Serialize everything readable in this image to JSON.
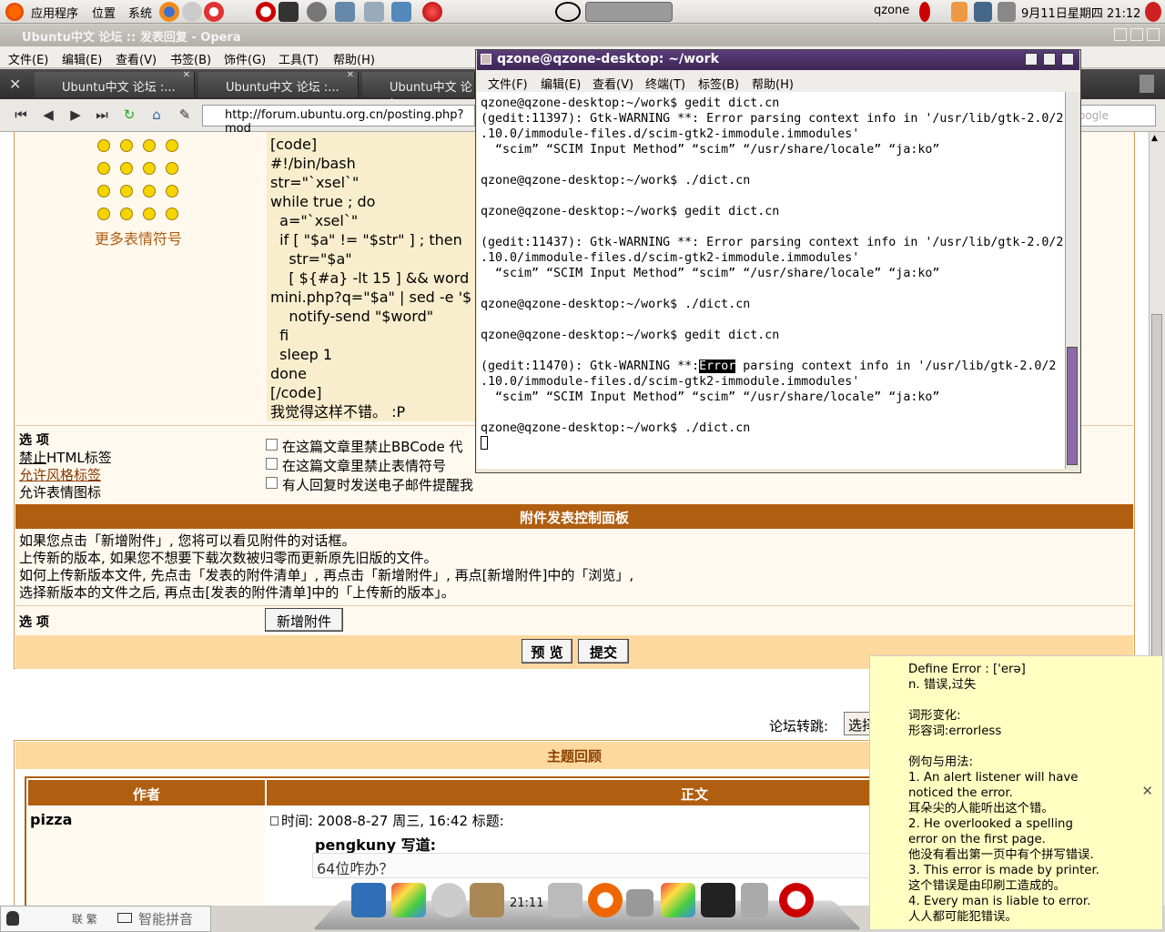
{
  "panel": {
    "menu_apps": "应用程序",
    "menu_places": "位置",
    "menu_system": "系统",
    "user": "qzone",
    "datetime": "9月11日星期四  21:12"
  },
  "browser": {
    "title": "Ubuntu中文 论坛 :: 发表回复 - Opera",
    "menu": [
      "文件(E)",
      "编辑(E)",
      "查看(V)",
      "书签(B)",
      "饰件(G)",
      "工具(T)",
      "帮助(H)"
    ],
    "tabs": [
      "Ubuntu中文 论坛 :...",
      "Ubuntu中文 论坛 :...",
      "Ubuntu中文 论坛"
    ],
    "url": "http://forum.ubuntu.org.cn/posting.php?mod",
    "search_placeholder": "oogle"
  },
  "post": {
    "more_smilies": "更多表情符号",
    "code_lines": "[code]\n#!/bin/bash\nstr=\"`xsel`\"\nwhile true ; do\n  a=\"`xsel`\"\n  if [ \"$a\" != \"$str\" ] ; then\n    str=\"$a\"\n    [ ${#a} -lt 15 ] && word\nmini.php?q=\"$a\" | sed -e '$\n    notify-send \"$word\"\n  fi\n  sleep 1\ndone\n[/code]\n我觉得这样不错。 :P",
    "options_title": "选 项",
    "opt_html_prefix": "禁止",
    "opt_html_suffix": "HTML标签",
    "opt_bbcode": "允许风格标签",
    "opt_smilies": "允许表情图标",
    "check_bbcode": "在这篇文章里禁止BBCode 代",
    "check_smilies": "在这篇文章里禁止表情符号",
    "check_notify": "有人回复时发送电子邮件提醒我",
    "attach_header": "附件发表控制面板",
    "attach_help": [
      "如果您点击「新增附件」, 您将可以看见附件的对话框。",
      "上传新的版本, 如果您不想要下载次数被归零而更新原先旧版的文件。",
      "如何上传新版本文件, 先点击「发表的附件清单」, 再点击「新增附件」, 再点[新增附件]中的「浏览」,",
      "选择新版本的文件之后, 再点击[发表的附件清单]中的「上传新的版本」。"
    ],
    "attach_options": "选 项",
    "add_attach_btn": "新增附件",
    "preview_btn": "预 览",
    "submit_btn": "提交",
    "forum_jump": "论坛转跳:",
    "forum_jump_value": "选择",
    "review_header": "主题回顾",
    "col_author": "作者",
    "col_body": "正文",
    "author_name": "pizza",
    "post_time": "时间: 2008-8-27 周三, 16:42    标题:",
    "quote_author": "pengkuny 写道:",
    "quote_text": "64位咋办？"
  },
  "terminal": {
    "title": "qzone@qzone-desktop: ~/work",
    "menu": [
      "文件(F)",
      "编辑(E)",
      "查看(V)",
      "终端(T)",
      "标签(B)",
      "帮助(H)"
    ],
    "lines": [
      "qzone@qzone-desktop:~/work$ gedit dict.cn",
      "",
      "(gedit:11397): Gtk-WARNING **: Error parsing context info in '/usr/lib/gtk-2.0/2",
      ".10.0/immodule-files.d/scim-gtk2-immodule.immodules'",
      "  “scim” “SCIM Input Method” “scim” “/usr/share/locale” “ja:ko”",
      "",
      "qzone@qzone-desktop:~/work$ ./dict.cn",
      "",
      "qzone@qzone-desktop:~/work$ gedit dict.cn",
      "",
      "(gedit:11437): Gtk-WARNING **: Error parsing context info in '/usr/lib/gtk-2.0/2",
      ".10.0/immodule-files.d/scim-gtk2-immodule.immodules'",
      "  “scim” “SCIM Input Method” “scim” “/usr/share/locale” “ja:ko”",
      "",
      "qzone@qzone-desktop:~/work$ ./dict.cn",
      "",
      "qzone@qzone-desktop:~/work$ gedit dict.cn",
      "",
      "(gedit:11470): Gtk-WARNING **:",
      ".10.0/immodule-files.d/scim-gtk2-immodule.immodules'",
      "  “scim” “SCIM Input Method” “scim” “/usr/share/locale” “ja:ko”",
      "",
      "qzone@qzone-desktop:~/work$ ./dict.cn"
    ],
    "hl_word": "Error",
    "hl_rest": " parsing context info in '/usr/lib/gtk-2.0/2"
  },
  "dict": {
    "lines": [
      "Define Error : ['erə]",
      "n. 错误,过失",
      "",
      "词形变化:",
      "形容词:errorless",
      "",
      "例句与用法:",
      "1. An alert listener will have",
      "noticed the error.",
      "   耳朵尖的人能听出这个错。",
      "2. He overlooked a spelling",
      "error on the first page.",
      "   他没有看出第一页中有个拼写错误.",
      "3. This error is made by printer.",
      "   这个错误是由印刷工造成的。",
      "4. Every man is liable to error.",
      "   人人都可能犯错误。"
    ],
    "close": "✕"
  },
  "dock": {
    "clock": "21:11"
  },
  "ime": {
    "label": "智能拼音",
    "mode": "联 繁"
  }
}
